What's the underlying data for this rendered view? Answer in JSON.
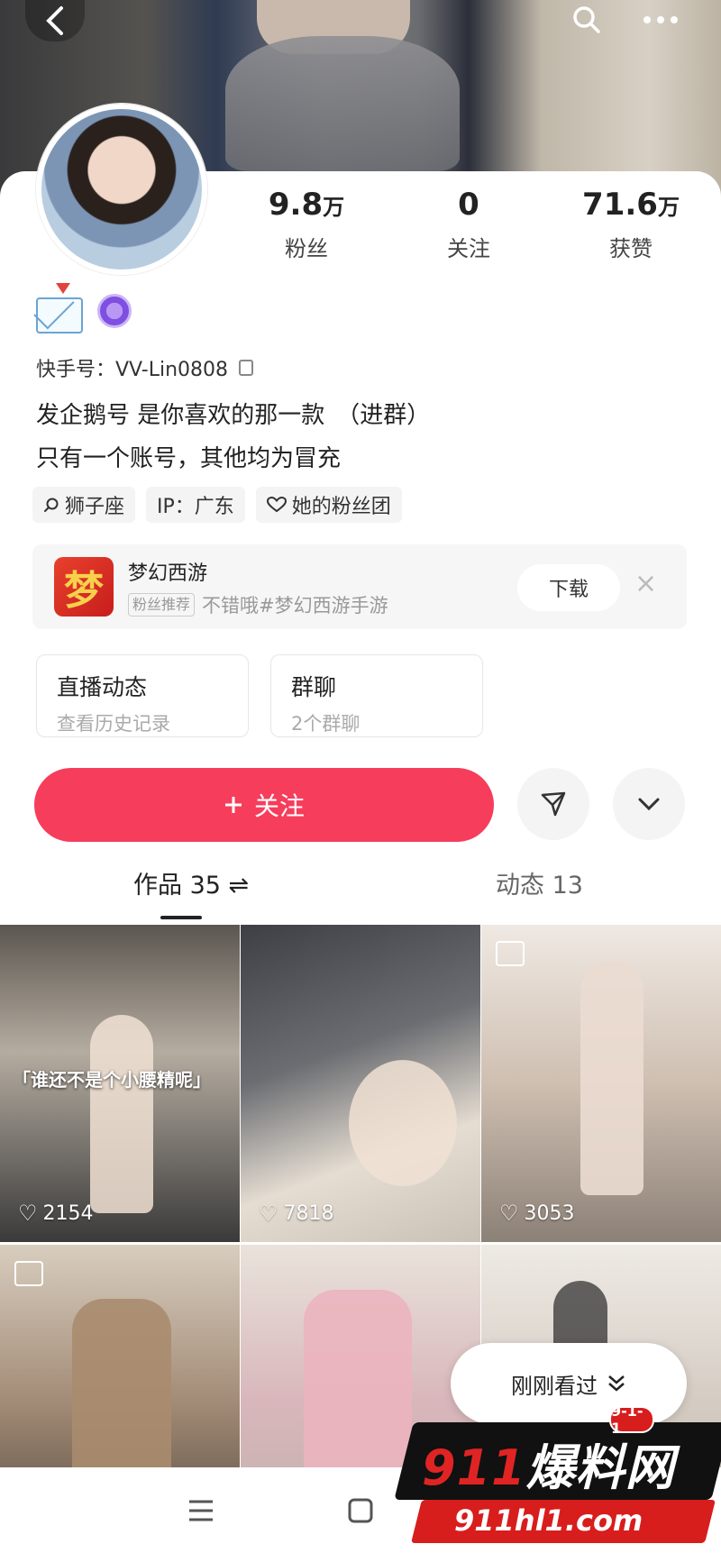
{
  "profile": {
    "stats": [
      {
        "value": "9.8",
        "unit": "万",
        "label": "粉丝"
      },
      {
        "value": "0",
        "unit": "",
        "label": "关注"
      },
      {
        "value": "71.6",
        "unit": "万",
        "label": "获赞"
      }
    ],
    "ks_id": "快手号：VV-Lin0808",
    "bio_line1": "发企鹅号 是你喜欢的那一款　（进群）",
    "bio_line2": "只有一个账号，其他均为冒充",
    "tags": [
      {
        "icon": "search-icon",
        "label": "狮子座"
      },
      {
        "icon": "",
        "label": "IP：广东"
      },
      {
        "icon": "heart-outline-icon",
        "label": "她的粉丝团"
      }
    ]
  },
  "ad": {
    "logo_char": "梦",
    "title": "梦幻西游",
    "chip": "粉丝推荐",
    "subtitle": "不错哦#梦幻西游手游",
    "download_label": "下载",
    "close": "×"
  },
  "cards": [
    {
      "title": "直播动态",
      "subtitle": "查看历史记录"
    },
    {
      "title": "群聊",
      "subtitle": "2个群聊"
    }
  ],
  "follow_label": "关注",
  "tabs": {
    "works": "作品 35 ⇌",
    "moments": "动态 13"
  },
  "videos": [
    {
      "likes": "2154",
      "caption": "「谁还不是个小腰精呢」"
    },
    {
      "likes": "7818",
      "caption": ""
    },
    {
      "likes": "3053",
      "caption": ""
    },
    {
      "likes": "",
      "caption": ""
    },
    {
      "likes": "",
      "caption": ""
    },
    {
      "likes": "",
      "caption": ""
    }
  ],
  "recent_label": "刚刚看过",
  "watermark": {
    "num": "911",
    "name": "爆料网",
    "badge": "9-1-1",
    "url": "911hl1.com"
  },
  "colors": {
    "accent": "#f63d5c",
    "watermark_red": "#d81d1d"
  }
}
